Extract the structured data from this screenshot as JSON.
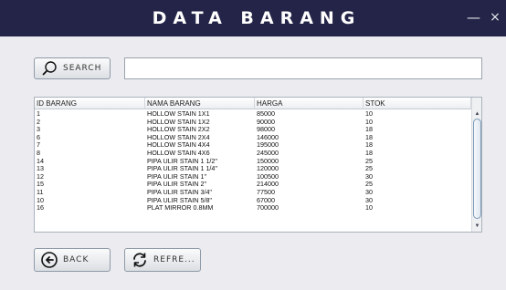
{
  "window": {
    "title": "DATA BARANG",
    "minimize_label": "—",
    "close_label": "×"
  },
  "search": {
    "button_label": "SEARCH",
    "input_value": "",
    "icon": "search-icon"
  },
  "table": {
    "columns": [
      "ID BARANG",
      "NAMA BARANG",
      "HARGA",
      "STOK"
    ],
    "rows": [
      [
        "1",
        "HOLLOW STAIN 1X1",
        "85000",
        "10"
      ],
      [
        "2",
        "HOLLOW STAIN 1X2",
        "90000",
        "10"
      ],
      [
        "3",
        "HOLLOW STAIN 2X2",
        "98000",
        "18"
      ],
      [
        "6",
        "HOLLOW STAIN 2X4",
        "146000",
        "18"
      ],
      [
        "7",
        "HOLLOW STAIN 4X4",
        "195000",
        "18"
      ],
      [
        "8",
        "HOLLOW STAIN 4X6",
        "245000",
        "18"
      ],
      [
        "14",
        "PIPA ULIR STAIN 1 1/2\"",
        "150000",
        "25"
      ],
      [
        "13",
        "PIPA ULIR STAIN 1 1/4\"",
        "120000",
        "25"
      ],
      [
        "12",
        "PIPA ULIR STAIN 1\"",
        "100500",
        "30"
      ],
      [
        "15",
        "PIPA ULIR STAIN 2\"",
        "214000",
        "25"
      ],
      [
        "11",
        "PIPA ULIR STAIN 3/4\"",
        "77500",
        "30"
      ],
      [
        "10",
        "PIPA ULIR STAIN 5/8\"",
        "67000",
        "30"
      ],
      [
        "16",
        "PLAT MIRROR 0.8MM",
        "700000",
        "10"
      ]
    ]
  },
  "scrollbar": {
    "up": "▲",
    "down": "▼"
  },
  "footer": {
    "back_label": "BACK",
    "refresh_label": "REFRE...",
    "back_icon": "back-arrow-icon",
    "refresh_icon": "refresh-icon"
  },
  "colors": {
    "titlebar": "#232447",
    "background": "#ececf0",
    "button_border": "#8e9aa8"
  }
}
